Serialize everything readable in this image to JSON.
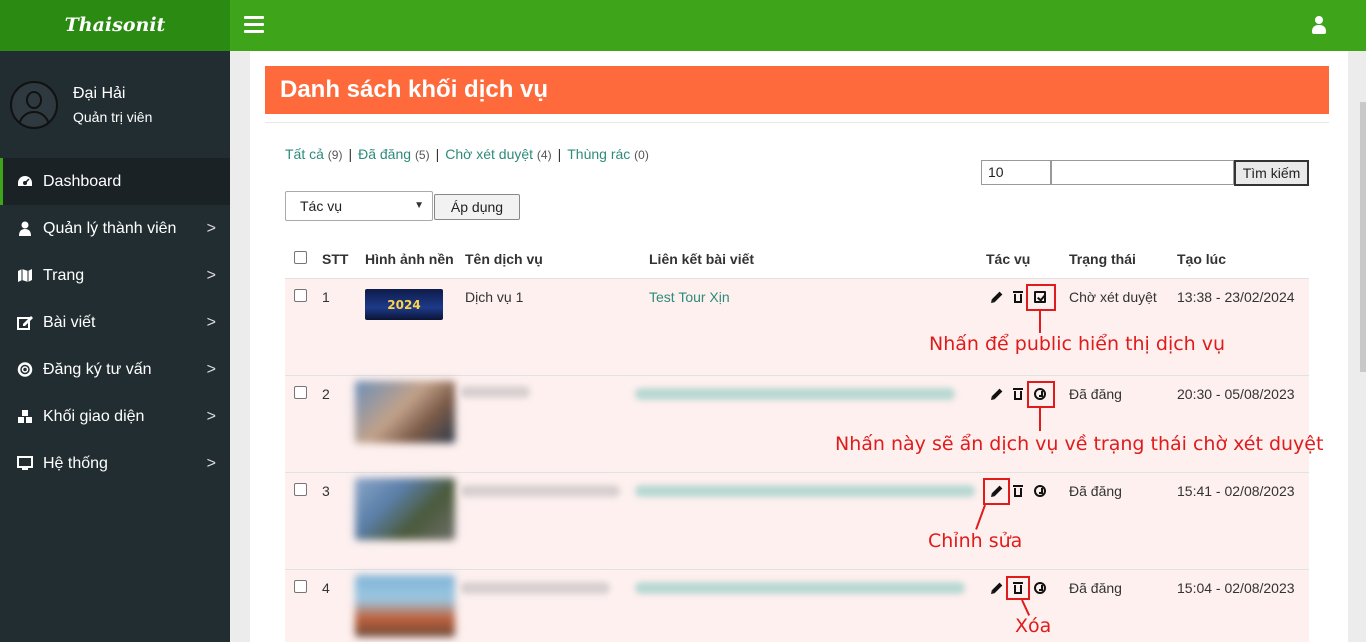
{
  "brand": {
    "logo_text": "Thaisonit"
  },
  "topbar": {
    "menu_icon": "bars-icon",
    "user_icon": "user-icon"
  },
  "profile": {
    "name": "Đại Hải",
    "role": "Quản trị viên"
  },
  "sidebar": {
    "items": [
      {
        "label": "Dashboard",
        "icon": "dashboard-icon",
        "active": true
      },
      {
        "label": "Quản lý thành viên",
        "icon": "user-icon"
      },
      {
        "label": "Trang",
        "icon": "map-icon"
      },
      {
        "label": "Bài viết",
        "icon": "edit-icon"
      },
      {
        "label": "Đăng ký tư vấn",
        "icon": "lifebuoy-icon"
      },
      {
        "label": "Khối giao diện",
        "icon": "cubes-icon"
      },
      {
        "label": "Hệ thống",
        "icon": "desktop-icon"
      }
    ],
    "chevron": ">"
  },
  "page": {
    "title": "Danh sách khối dịch vụ",
    "filters": [
      {
        "label": "Tất cả",
        "count": "(9)"
      },
      {
        "label": "Đã đăng",
        "count": "(5)"
      },
      {
        "label": "Chờ xét duyệt",
        "count": "(4)"
      },
      {
        "label": "Thùng rác",
        "count": "(0)"
      }
    ],
    "separator": "|",
    "per_page": "10",
    "search_button": "Tìm kiếm",
    "bulk_action": "Tác vụ",
    "apply_button": "Áp dụng"
  },
  "table": {
    "headers": [
      "STT",
      "Hình ảnh nền",
      "Tên dịch vụ",
      "Liên kết bài viết",
      "Tác vụ",
      "Trạng thái",
      "Tạo lúc"
    ],
    "rows": [
      {
        "stt": "1",
        "thumb_text": "2024",
        "name": "Dịch vụ 1",
        "link": "Test Tour Xịn",
        "status": "Chờ xét duyệt",
        "created": "13:38 - 23/02/2024"
      },
      {
        "stt": "2",
        "status": "Đã đăng",
        "created": "20:30 - 05/08/2023"
      },
      {
        "stt": "3",
        "status": "Đã đăng",
        "created": "15:41 - 02/08/2023"
      },
      {
        "stt": "4",
        "status": "Đã đăng",
        "created": "15:04 - 02/08/2023"
      }
    ]
  },
  "annotations": {
    "publish": "Nhấn để public hiển thị dịch vụ",
    "unpublish": "Nhấn này sẽ ẩn dịch vụ về trạng thái chờ xét duyệt",
    "edit": "Chỉnh sửa",
    "delete": "Xóa",
    "color": "#e01b1b"
  },
  "colors": {
    "brand_green": "#2a8a12",
    "topbar_green": "#3ea51a",
    "title_orange": "#ff6a3d",
    "sidebar_bg": "#222d32",
    "link_teal": "#2e8b7b"
  }
}
